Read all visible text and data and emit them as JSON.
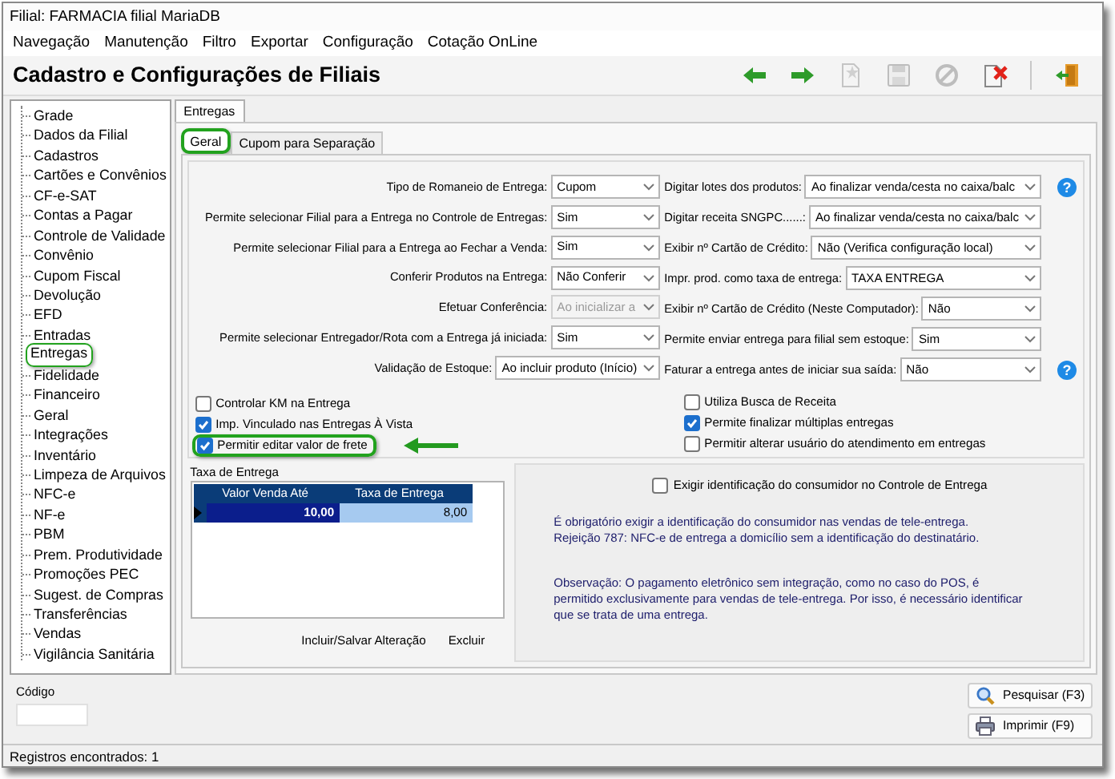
{
  "window": {
    "title": "Filial: FARMACIA filial MariaDB"
  },
  "menu": [
    "Navegação",
    "Manutenção",
    "Filtro",
    "Exportar",
    "Configuração",
    "Cotação OnLine"
  ],
  "header": {
    "title": "Cadastro e Configurações de Filiais"
  },
  "toolbar": [
    {
      "kind": "back",
      "disabled": false
    },
    {
      "kind": "forward",
      "disabled": false
    },
    {
      "kind": "new",
      "disabled": true
    },
    {
      "kind": "save",
      "disabled": true
    },
    {
      "kind": "cancel",
      "disabled": true
    },
    {
      "kind": "delete",
      "disabled": false
    },
    {
      "kind": "separator"
    },
    {
      "kind": "exit",
      "disabled": false
    }
  ],
  "sidebar": {
    "items": [
      {
        "label": "Grade",
        "highlighted": false
      },
      {
        "label": "Dados da Filial",
        "highlighted": false
      },
      {
        "label": "Cadastros",
        "highlighted": false
      },
      {
        "label": "Cartões e Convênios",
        "highlighted": false
      },
      {
        "label": "CF-e-SAT",
        "highlighted": false
      },
      {
        "label": "Contas a Pagar",
        "highlighted": false
      },
      {
        "label": "Controle de Validade",
        "highlighted": false
      },
      {
        "label": "Convênio",
        "highlighted": false
      },
      {
        "label": "Cupom Fiscal",
        "highlighted": false
      },
      {
        "label": "Devolução",
        "highlighted": false
      },
      {
        "label": "EFD",
        "highlighted": false
      },
      {
        "label": "Entradas",
        "highlighted": false
      },
      {
        "label": "Entregas",
        "highlighted": true
      },
      {
        "label": "Fidelidade",
        "highlighted": false
      },
      {
        "label": "Financeiro",
        "highlighted": false
      },
      {
        "label": "Geral",
        "highlighted": false
      },
      {
        "label": "Integrações",
        "highlighted": false
      },
      {
        "label": "Inventário",
        "highlighted": false
      },
      {
        "label": "Limpeza de Arquivos",
        "highlighted": false
      },
      {
        "label": "NFC-e",
        "highlighted": false
      },
      {
        "label": "NF-e",
        "highlighted": false
      },
      {
        "label": "PBM",
        "highlighted": false
      },
      {
        "label": "Prem. Produtividade",
        "highlighted": false
      },
      {
        "label": "Promoções PEC",
        "highlighted": false
      },
      {
        "label": "Sugest. de Compras",
        "highlighted": false
      },
      {
        "label": "Transferências",
        "highlighted": false
      },
      {
        "label": "Vendas",
        "highlighted": false
      },
      {
        "label": "Vigilância Sanitária",
        "highlighted": false
      }
    ]
  },
  "outer_tabs": [
    {
      "label": "Entregas",
      "selected": true
    }
  ],
  "inner_tabs": [
    {
      "label": "Geral",
      "selected": true,
      "highlighted": true
    },
    {
      "label": "Cupom para Separação",
      "selected": false,
      "highlighted": false
    }
  ],
  "left_fields": [
    {
      "label": "Tipo de Romaneio de Entrega:",
      "value": "Cupom",
      "disabled": false
    },
    {
      "label": "Permite selecionar Filial para a Entrega no Controle de Entregas:",
      "value": "Sim",
      "disabled": false
    },
    {
      "label": "Permite selecionar Filial para a Entrega ao Fechar a Venda:",
      "value": "Sim",
      "disabled": false
    },
    {
      "label": "Conferir Produtos na Entrega:",
      "value": "Não Conferir",
      "disabled": false
    },
    {
      "label": "Efetuar Conferência:",
      "value": "Ao inicializar a",
      "disabled": true
    },
    {
      "label": "Permite selecionar Entregador/Rota com a Entrega já iniciada:",
      "value": "Sim",
      "disabled": false
    },
    {
      "label": "Validação de Estoque:",
      "value": "Ao incluir produto (Início)",
      "disabled": false
    }
  ],
  "right_fields": [
    {
      "label": "Digitar lotes dos produtos:",
      "value": "Ao finalizar venda/cesta no caixa/balc",
      "help": "?"
    },
    {
      "label": "Digitar receita SNGPC......:",
      "value": "Ao finalizar venda/cesta no caixa/balc"
    },
    {
      "label": "Exibir nº Cartão de Crédito:",
      "value": "Não (Verifica configuração local)"
    },
    {
      "label": "Impr. prod. como taxa de entrega:",
      "value": "TAXA ENTREGA"
    },
    {
      "label": "Exibir nº Cartão de Crédito (Neste Computador):",
      "value": "Não"
    },
    {
      "label": "Permite enviar entrega para filial sem estoque:",
      "value": "Sim"
    },
    {
      "label": "Faturar a entrega antes de iniciar sua saída:",
      "value": "Não",
      "help": "?"
    }
  ],
  "left_checks": [
    {
      "label": "Controlar KM na Entrega",
      "checked": false,
      "highlighted": false
    },
    {
      "label": "Imp. Vinculado nas Entregas À Vista",
      "checked": true,
      "highlighted": false
    },
    {
      "label": "Permitir editar valor de frete",
      "checked": true,
      "highlighted": true
    }
  ],
  "right_checks": [
    {
      "label": "Utiliza Busca de Receita",
      "checked": false
    },
    {
      "label": "Permite finalizar múltiplas entregas",
      "checked": true
    },
    {
      "label": "Permitir alterar usuário do atendimento em entregas",
      "checked": false
    }
  ],
  "delivery_fee": {
    "title": "Taxa de Entrega",
    "columns": [
      "Valor Venda Até",
      "Taxa de Entrega"
    ],
    "rows": [
      {
        "cells": [
          "10,00",
          "8,00"
        ],
        "selected": true
      }
    ],
    "buttons": [
      "Incluir/Salvar Alteração",
      "Excluir"
    ]
  },
  "consumer": {
    "checkbox": {
      "label": "Exigir identificação do consumidor no Controle de Entrega",
      "checked": false
    },
    "notes": [
      [
        "É obrigatório exigir a identificação do consumidor nas vendas de tele-entrega.",
        "Rejeição 787: NFC-e de entrega a domicílio sem a identificação do destinatário."
      ],
      [
        "Observação: O pagamento eletrônico sem integração, como no caso do POS, é",
        "permitido exclusivamente para vendas de tele-entrega. Por isso, é necessário identificar",
        "que se trata de uma entrega."
      ]
    ]
  },
  "footer": {
    "code_label": "Código",
    "buttons": [
      {
        "kind": "search",
        "label": "Pesquisar (F3)"
      },
      {
        "kind": "print",
        "label": "Imprimir (F9)"
      }
    ]
  },
  "status_bar": "Registros encontrados: 1"
}
